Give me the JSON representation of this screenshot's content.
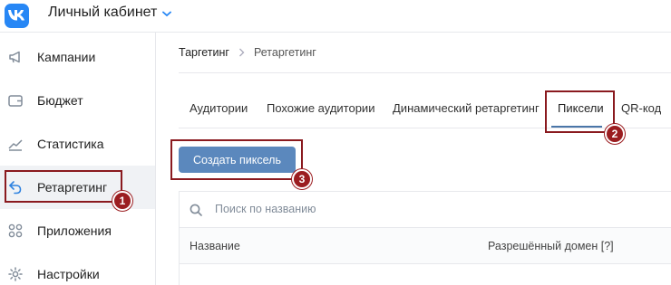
{
  "header": {
    "title": "Личный кабинет",
    "logo_icon": "vk-logo-icon",
    "dropdown_icon": "chevron-down-icon",
    "accent_color": "#2787f5"
  },
  "sidebar": {
    "items": [
      {
        "label": "Кампании",
        "icon": "megaphone-icon"
      },
      {
        "label": "Бюджет",
        "icon": "wallet-icon"
      },
      {
        "label": "Статистика",
        "icon": "chart-icon"
      },
      {
        "label": "Ретаргетинг",
        "icon": "retarget-arrow-icon",
        "active": true
      },
      {
        "label": "Приложения",
        "icon": "apps-icon"
      },
      {
        "label": "Настройки",
        "icon": "gear-icon"
      }
    ]
  },
  "breadcrumb": {
    "items": [
      "Таргетинг",
      "Ретаргетинг"
    ]
  },
  "tabs": {
    "items": [
      {
        "label": "Аудитории"
      },
      {
        "label": "Похожие аудитории"
      },
      {
        "label": "Динамический ретаргетинг"
      },
      {
        "label": "Пиксели",
        "active": true
      },
      {
        "label": "QR-код"
      }
    ]
  },
  "actions": {
    "create_pixel_label": "Создать пиксель",
    "button_color": "#5b88bd"
  },
  "search": {
    "placeholder": "Поиск по названию"
  },
  "table": {
    "columns": [
      "Название",
      "Разрешённый домен [?]"
    ]
  },
  "annotations": {
    "markers": [
      "1",
      "2",
      "3"
    ],
    "color": "#9b1d20"
  }
}
